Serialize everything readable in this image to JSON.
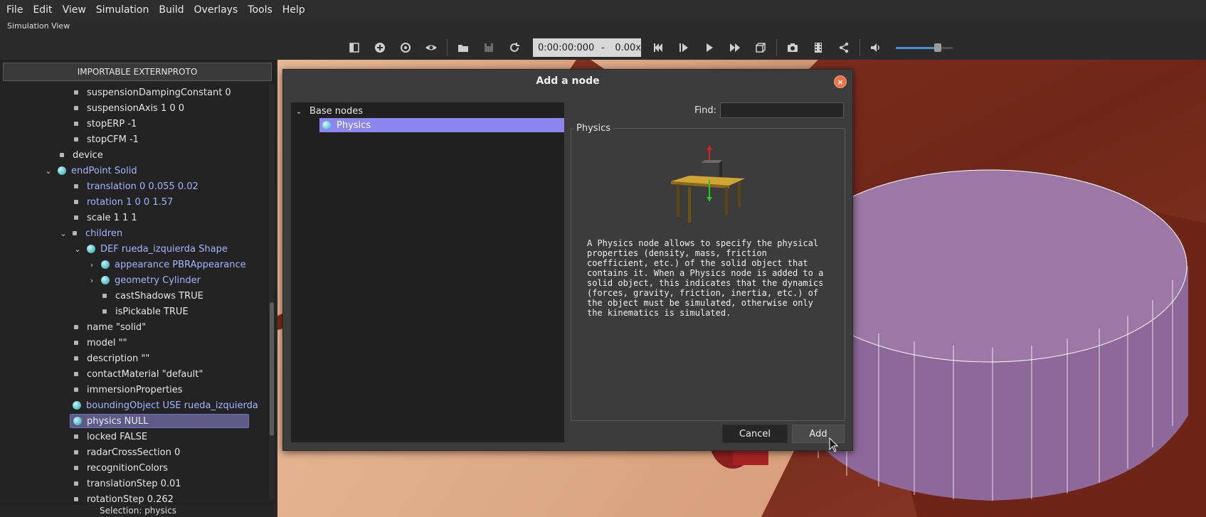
{
  "menu": [
    "File",
    "Edit",
    "View",
    "Simulation",
    "Build",
    "Overlays",
    "Tools",
    "Help"
  ],
  "subtitle": "Simulation View",
  "toolbar": {
    "time": "0:00:00:000",
    "dash": "-",
    "speed": "0.00x",
    "volume_level": 0.74
  },
  "left_panel": {
    "extern_button": "IMPORTABLE EXTERNPROTO",
    "tree": [
      {
        "label": "suspensionDampingConstant 0"
      },
      {
        "label": "suspensionAxis 1 0 0"
      },
      {
        "label": "stopERP -1"
      },
      {
        "label": "stopCFM -1"
      },
      {
        "label": "device"
      },
      {
        "label": "endPoint Solid"
      },
      {
        "label": "translation 0 0.055 0.02"
      },
      {
        "label": "rotation 1 0 0 1.57"
      },
      {
        "label": "scale 1 1 1"
      },
      {
        "label": "children"
      },
      {
        "label": "DEF rueda_izquierda Shape"
      },
      {
        "label": "appearance PBRAppearance"
      },
      {
        "label": "geometry Cylinder"
      },
      {
        "label": "castShadows TRUE"
      },
      {
        "label": "isPickable TRUE"
      },
      {
        "label": "name \"solid\""
      },
      {
        "label": "model \"\""
      },
      {
        "label": "description \"\""
      },
      {
        "label": "contactMaterial \"default\""
      },
      {
        "label": "immersionProperties"
      },
      {
        "label": "boundingObject USE rueda_izquierda"
      },
      {
        "label": "physics NULL"
      },
      {
        "label": "locked FALSE"
      },
      {
        "label": "radarCrossSection 0"
      },
      {
        "label": "recognitionColors"
      },
      {
        "label": "translationStep 0.01"
      },
      {
        "label": "rotationStep 0.262"
      }
    ],
    "status": "Selection: physics"
  },
  "dialog": {
    "title": "Add a node",
    "close": "×",
    "tree_root": "Base nodes",
    "tree_item": "Physics",
    "find_label": "Find:",
    "find_value": "",
    "info_title": "Physics",
    "description": "A Physics node allows to specify the physical\nproperties (density, mass, friction\ncoefficient, etc.) of the solid object that\ncontains it. When a Physics node is added to a\nsolid object, this indicates that the dynamics\n(forces, gravity, friction, inertia, etc.) of\nthe object must be simulated, otherwise only\nthe kinematics is simulated.",
    "cancel": "Cancel",
    "add": "Add"
  },
  "colors": {
    "selection": "#8b86f0",
    "tree_blue": "#a6b3ff",
    "cylinder": "#9d78a6"
  }
}
